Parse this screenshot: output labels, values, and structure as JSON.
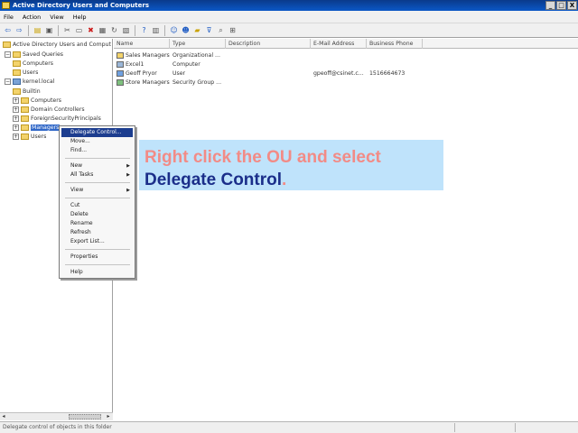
{
  "window": {
    "title": "Active Directory Users and Computers",
    "min": "_",
    "max": "□",
    "close": "X"
  },
  "menu": [
    "File",
    "Action",
    "View",
    "Help"
  ],
  "toolbar": {
    "icons": [
      "back-icon",
      "forward-icon",
      "up-icon",
      "show-hide-icon",
      "cut-icon",
      "copy-icon",
      "delete-icon",
      "properties-icon",
      "refresh-icon",
      "export-icon",
      "help-icon",
      "console-icon",
      "new-user-icon",
      "new-group-icon",
      "new-ou-icon",
      "filter-icon",
      "find-icon",
      "add-group-icon"
    ],
    "glyphs": [
      "⇦",
      "⇨",
      "▤",
      "▣",
      "✂",
      "▭",
      "✖",
      "▦",
      "↻",
      "▧",
      "?",
      "▥",
      "☺",
      "☻",
      "▰",
      "⊽",
      "⌕",
      "⊞"
    ]
  },
  "tree": [
    {
      "label": "Active Directory Users and Comput",
      "indent": 0,
      "kind": "root",
      "expander": ""
    },
    {
      "label": "Saved Queries",
      "indent": 1,
      "kind": "folder",
      "expander": "−"
    },
    {
      "label": "Computers",
      "indent": 2,
      "kind": "folder",
      "expander": ""
    },
    {
      "label": "Users",
      "indent": 2,
      "kind": "folder",
      "expander": ""
    },
    {
      "label": "kernel.local",
      "indent": 1,
      "kind": "domain",
      "expander": "−"
    },
    {
      "label": "Builtin",
      "indent": 2,
      "kind": "folder",
      "expander": ""
    },
    {
      "label": "Computers",
      "indent": 2,
      "kind": "folder",
      "expander": "+"
    },
    {
      "label": "Domain Controllers",
      "indent": 2,
      "kind": "folder",
      "expander": "+"
    },
    {
      "label": "ForeignSecurityPrincipals",
      "indent": 2,
      "kind": "folder",
      "expander": "+"
    },
    {
      "label": "Managers",
      "indent": 2,
      "kind": "folder",
      "expander": "+",
      "selected": true
    },
    {
      "label": "Users",
      "indent": 2,
      "kind": "folder",
      "expander": "+"
    }
  ],
  "columns": [
    "Name",
    "Type",
    "Description",
    "E-Mail Address",
    "Business Phone"
  ],
  "rows": [
    {
      "name": "Sales Managers",
      "type": "Organizational ...",
      "desc": "",
      "email": "",
      "phone": "",
      "icon": "ou-icon",
      "color": "#f3d36b"
    },
    {
      "name": "Excel1",
      "type": "Computer",
      "desc": "",
      "email": "",
      "phone": "",
      "icon": "computer-icon",
      "color": "#9bb7d8"
    },
    {
      "name": "Geoff Pryor",
      "type": "User",
      "desc": "",
      "email": "gpeoff@csinet.c...",
      "phone": "1516664673",
      "icon": "user-icon",
      "color": "#6fa0e0"
    },
    {
      "name": "Store Managers",
      "type": "Security Group ...",
      "desc": "",
      "email": "",
      "phone": "",
      "icon": "group-icon",
      "color": "#7ec07e"
    }
  ],
  "context_menu": [
    {
      "label": "Delegate Control...",
      "highlight": true
    },
    {
      "label": "Move..."
    },
    {
      "label": "Find..."
    },
    {
      "sep": true
    },
    {
      "label": "New",
      "submenu": true
    },
    {
      "label": "All Tasks",
      "submenu": true
    },
    {
      "sep": true
    },
    {
      "label": "View",
      "submenu": true
    },
    {
      "sep": true
    },
    {
      "label": "Cut"
    },
    {
      "label": "Delete"
    },
    {
      "label": "Rename"
    },
    {
      "label": "Refresh"
    },
    {
      "label": "Export List..."
    },
    {
      "sep": true
    },
    {
      "label": "Properties"
    },
    {
      "sep": true
    },
    {
      "label": "Help"
    }
  ],
  "callout": {
    "line1": "Right click the OU and select",
    "line2_bold": "Delegate Control",
    "line2_end": "."
  },
  "statusbar": {
    "text": "Delegate control of objects in this folder"
  },
  "colors": {
    "title_bar": "#0b58c6",
    "selection": "#3168c8",
    "menu_highlight": "#1c3d8f",
    "callout_bg": "#bfe3fb",
    "callout_pink": "#f28b86",
    "callout_navy": "#1b2e8a"
  }
}
